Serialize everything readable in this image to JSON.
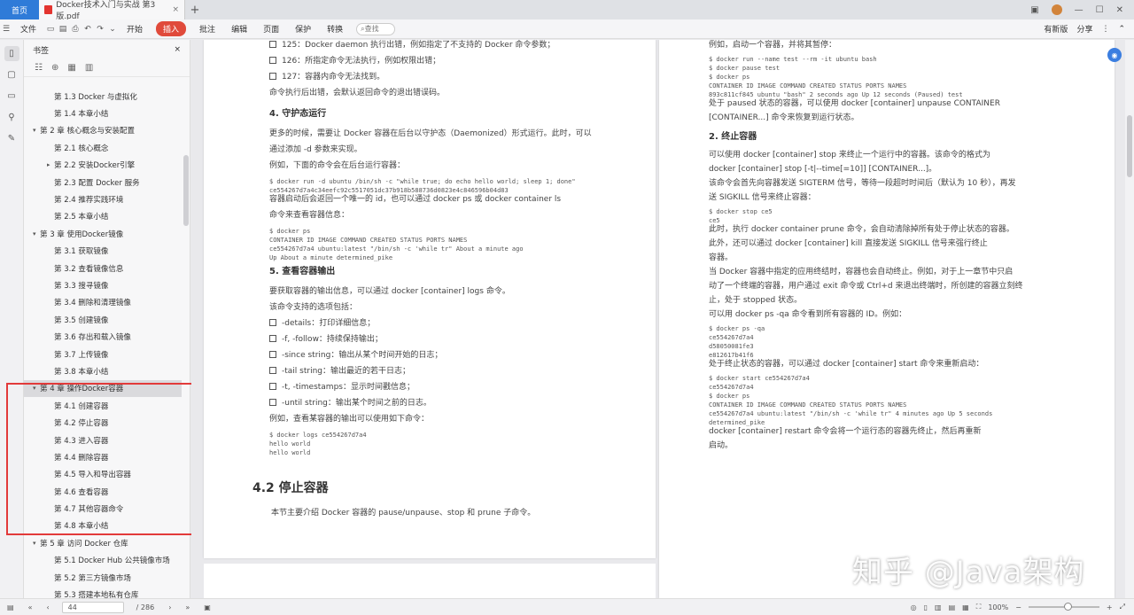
{
  "tabs": {
    "home": "首页",
    "doc_title": "Docker技术入门与实战 第3版.pdf",
    "close": "×",
    "new_tab": "+"
  },
  "toolbar": {
    "file_menu": "文件",
    "items": [
      "开始",
      "插入",
      "批注",
      "编辑",
      "页面",
      "保护",
      "转换"
    ],
    "start_label": "插入",
    "search_placeholder": "查找",
    "right_items": [
      "有新版",
      "分享"
    ]
  },
  "sidebar": {
    "title": "书签",
    "close": "×",
    "toc": [
      {
        "level": 2,
        "label": "第 1.3 Docker 与虚拟化"
      },
      {
        "level": 2,
        "label": "第 1.4 本章小结"
      },
      {
        "level": 1,
        "label": "第 2 章 核心概念与安装配置",
        "expanded": true
      },
      {
        "level": 2,
        "label": "第 2.1 核心概念"
      },
      {
        "level": 2,
        "label": "第 2.2 安装Docker引擎",
        "collapsed": true
      },
      {
        "level": 2,
        "label": "第 2.3 配置 Docker 服务"
      },
      {
        "level": 2,
        "label": "第 2.4 推荐实践环境"
      },
      {
        "level": 2,
        "label": "第 2.5 本章小结"
      },
      {
        "level": 1,
        "label": "第 3 章 使用Docker镜像",
        "expanded": true
      },
      {
        "level": 2,
        "label": "第 3.1 获取镜像"
      },
      {
        "level": 2,
        "label": "第 3.2 查看镜像信息"
      },
      {
        "level": 2,
        "label": "第 3.3 搜寻镜像"
      },
      {
        "level": 2,
        "label": "第 3.4 删除和清理镜像"
      },
      {
        "level": 2,
        "label": "第 3.5 创建镜像"
      },
      {
        "level": 2,
        "label": "第 3.6 存出和载入镜像"
      },
      {
        "level": 2,
        "label": "第 3.7 上传镜像"
      },
      {
        "level": 2,
        "label": "第 3.8 本章小结"
      },
      {
        "level": 1,
        "label": "第 4 章 操作Docker容器",
        "expanded": true,
        "selected": true
      },
      {
        "level": 2,
        "label": "第 4.1 创建容器"
      },
      {
        "level": 2,
        "label": "第 4.2 停止容器"
      },
      {
        "level": 2,
        "label": "第 4.3 进入容器"
      },
      {
        "level": 2,
        "label": "第 4.4 删除容器"
      },
      {
        "level": 2,
        "label": "第 4.5 导入和导出容器"
      },
      {
        "level": 2,
        "label": "第 4.6 查看容器"
      },
      {
        "level": 2,
        "label": "第 4.7 其他容器命令"
      },
      {
        "level": 2,
        "label": "第 4.8 本章小结"
      },
      {
        "level": 1,
        "label": "第 5 章 访问 Docker 仓库",
        "expanded": true
      },
      {
        "level": 2,
        "label": "第 5.1 Docker Hub 公共镜像市场"
      },
      {
        "level": 2,
        "label": "第 5.2 第三方镜像市场"
      },
      {
        "level": 2,
        "label": "第 5.3 搭建本地私有仓库"
      }
    ]
  },
  "page_left": {
    "lines": [
      {
        "t": "cb",
        "text": "125：Docker daemon 执行出错，例如指定了不支持的 Docker 命令参数；"
      },
      {
        "t": "cb",
        "text": "126：所指定命令无法执行，例如权限出错；"
      },
      {
        "t": "cb",
        "text": "127：容器内命令无法找到。"
      },
      {
        "t": "p",
        "text": "命令执行后出错，会默认返回命令的退出错误码。"
      },
      {
        "t": "h4",
        "text": "4. 守护态运行"
      },
      {
        "t": "p",
        "text": "更多的时候，需要让 Docker 容器在后台以守护态（Daemonized）形式运行。此时，可以"
      },
      {
        "t": "p",
        "text": "通过添加 -d 参数来实现。"
      },
      {
        "t": "p",
        "text": "例如，下面的命令会在后台运行容器："
      },
      {
        "t": "code",
        "text": "$ docker run -d ubuntu /bin/sh -c \"while true; do echo hello world; sleep 1; done\""
      },
      {
        "t": "code",
        "text": "ce554267d7a4c34eefc92c5517051dc37b918b588736d0823e4c846596b04d83"
      },
      {
        "t": "p",
        "text": "容器启动后会返回一个唯一的 id，也可以通过 docker ps 或 docker container ls"
      },
      {
        "t": "p",
        "text": "命令来查看容器信息："
      },
      {
        "t": "code",
        "text": "$ docker ps"
      },
      {
        "t": "code",
        "text": "CONTAINER ID   IMAGE     COMMAND         CREATED     STATUS     PORTS   NAMES"
      },
      {
        "t": "code",
        "text": "ce554267d7a4   ubuntu:latest   \"/bin/sh -c 'while tr\"   About a minute ago"
      },
      {
        "t": "code",
        "text": "    Up About a minute   determined_pike"
      },
      {
        "t": "h4",
        "text": "5. 查看容器输出"
      },
      {
        "t": "p",
        "text": "要获取容器的输出信息，可以通过 docker [container] logs 命令。"
      },
      {
        "t": "p",
        "text": "该命令支持的选项包括："
      },
      {
        "t": "cb",
        "text": "-details：打印详细信息；"
      },
      {
        "t": "cb",
        "text": "-f, -follow：持续保持输出；"
      },
      {
        "t": "cb",
        "text": "-since string：输出从某个时间开始的日志；"
      },
      {
        "t": "cb",
        "text": "-tail string：输出最近的若干日志；"
      },
      {
        "t": "cb",
        "text": "-t, -timestamps：显示时间戳信息；"
      },
      {
        "t": "cb",
        "text": "-until string：输出某个时间之前的日志。"
      },
      {
        "t": "p",
        "text": "例如，查看某容器的输出可以使用如下命令："
      },
      {
        "t": "code",
        "text": "$ docker logs ce554267d7a4"
      },
      {
        "t": "code",
        "text": "hello world"
      },
      {
        "t": "code",
        "text": "hello world"
      }
    ],
    "section_title": "4.2 停止容器",
    "section_intro": "本节主要介绍 Docker 容器的 pause/unpause、stop 和 prune 子命令。"
  },
  "page_right": {
    "lines": [
      {
        "t": "p",
        "text": "例如，启动一个容器，并将其暂停："
      },
      {
        "t": "code",
        "text": "$ docker run --name test --rm -it ubuntu bash"
      },
      {
        "t": "code",
        "text": "$ docker pause test"
      },
      {
        "t": "code",
        "text": "$ docker ps"
      },
      {
        "t": "code",
        "text": "CONTAINER ID  IMAGE  COMMAND  CREATED  STATUS  PORTS  NAMES"
      },
      {
        "t": "code",
        "text": "893c811cf845  ubuntu  \"bash\"  2 seconds ago  Up 12 seconds (Paused)  test"
      },
      {
        "t": "p",
        "text": "处于 paused 状态的容器，可以使用 docker [container] unpause CONTAINER"
      },
      {
        "t": "p",
        "text": "[CONTAINER...] 命令来恢复到运行状态。"
      },
      {
        "t": "h4",
        "text": "2. 终止容器"
      },
      {
        "t": "p",
        "text": "可以使用 docker [container] stop 来终止一个运行中的容器。该命令的格式为"
      },
      {
        "t": "p",
        "text": "docker [container] stop [-t|--time[=10]] [CONTAINER...]。"
      },
      {
        "t": "p",
        "text": "该命令会首先向容器发送 SIGTERM 信号，等待一段超时时间后（默认为 10 秒），再发"
      },
      {
        "t": "p",
        "text": "送 SIGKILL 信号来终止容器："
      },
      {
        "t": "code",
        "text": "$ docker stop ce5"
      },
      {
        "t": "code",
        "text": "ce5"
      },
      {
        "t": "p",
        "text": "此时，执行 docker container prune 命令，会自动清除掉所有处于停止状态的容器。"
      },
      {
        "t": "p",
        "text": "此外，还可以通过 docker [container] kill 直接发送 SIGKILL 信号来强行终止"
      },
      {
        "t": "p",
        "text": "容器。"
      },
      {
        "t": "p",
        "text": "当 Docker 容器中指定的应用终结时，容器也会自动终止。例如，对于上一章节中只启"
      },
      {
        "t": "p",
        "text": "动了一个终端的容器，用户通过 exit 命令或 Ctrl+d 来退出终端时，所创建的容器立刻终"
      },
      {
        "t": "p",
        "text": "止，处于 stopped 状态。"
      },
      {
        "t": "p",
        "text": "可以用 docker ps -qa 命令看到所有容器的 ID。例如："
      },
      {
        "t": "code",
        "text": "$ docker ps -qa"
      },
      {
        "t": "code",
        "text": "ce554267d7a4"
      },
      {
        "t": "code",
        "text": "d58050081fe3"
      },
      {
        "t": "code",
        "text": "e812617b41f6"
      },
      {
        "t": "p",
        "text": "处于终止状态的容器，可以通过 docker [container] start 命令来重新启动："
      },
      {
        "t": "code",
        "text": "$ docker start ce554267d7a4"
      },
      {
        "t": "code",
        "text": "ce554267d7a4"
      },
      {
        "t": "code",
        "text": "$ docker ps"
      },
      {
        "t": "code",
        "text": "CONTAINER ID  IMAGE  COMMAND  CREATED  STATUS  PORTS  NAMES"
      },
      {
        "t": "code",
        "text": "ce554267d7a4  ubuntu:latest  \"/bin/sh -c 'while tr\"  4 minutes ago  Up 5 seconds"
      },
      {
        "t": "code",
        "text": "    determined_pike"
      },
      {
        "t": "p",
        "text": "docker [container] restart 命令会将一个运行态的容器先终止，然后再重新"
      },
      {
        "t": "p",
        "text": "启动。"
      }
    ]
  },
  "watermark": "知乎 @Java架构",
  "statusbar": {
    "page_value": "44",
    "page_total": "/ 286",
    "zoom": "100%"
  }
}
